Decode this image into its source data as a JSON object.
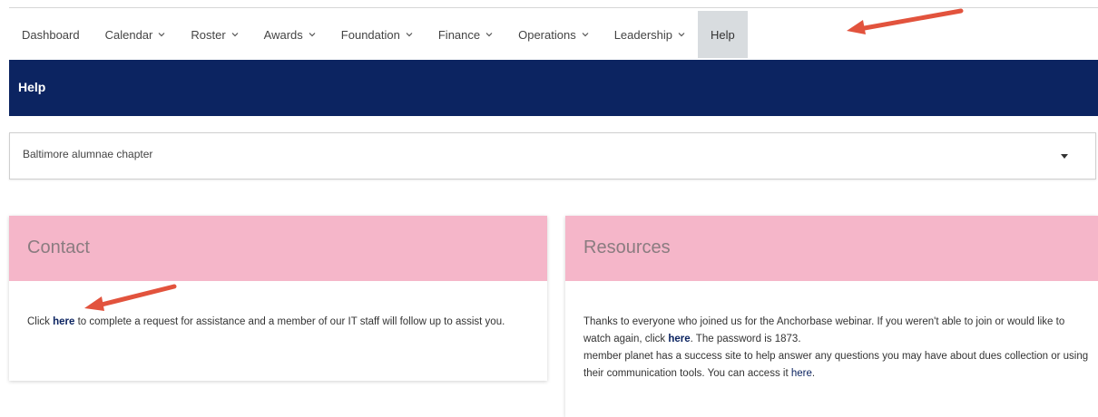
{
  "nav": {
    "items": [
      {
        "label": "Dashboard",
        "dropdown": false
      },
      {
        "label": "Calendar",
        "dropdown": true
      },
      {
        "label": "Roster",
        "dropdown": true
      },
      {
        "label": "Awards",
        "dropdown": true
      },
      {
        "label": "Foundation",
        "dropdown": true
      },
      {
        "label": "Finance",
        "dropdown": true
      },
      {
        "label": "Operations",
        "dropdown": true
      },
      {
        "label": "Leadership",
        "dropdown": true
      },
      {
        "label": "Help",
        "dropdown": false,
        "active": true
      }
    ]
  },
  "help_bar": {
    "title": "Help"
  },
  "chapter_select": {
    "value": "Baltimore alumnae chapter"
  },
  "contact": {
    "title": "Contact",
    "text_before": "Click ",
    "link": "here",
    "text_after": " to complete a request for assistance and a member of our IT staff will follow up to assist you."
  },
  "resources": {
    "title": "Resources",
    "p1_before": "Thanks to everyone who joined us for the Anchorbase webinar. If you weren't able to join or would like to watch again, click ",
    "p1_link": "here",
    "p1_after": ". The password is 1873.",
    "p2_before": "member planet has a success site to help answer any questions you may have about dues collection or using their communication tools.  You can access it ",
    "p2_link": "here",
    "p2_after": "."
  },
  "colors": {
    "help_bar_bg": "#0c2461",
    "card_header_pink": "#f5b6c9",
    "active_tab_bg": "#d8dcdf",
    "annotation_arrow": "#e2533d"
  },
  "icons": {
    "nav_dropdown": "chevron-down-icon",
    "select": "caret-down-icon",
    "annotation": "red-arrow-annotation"
  }
}
